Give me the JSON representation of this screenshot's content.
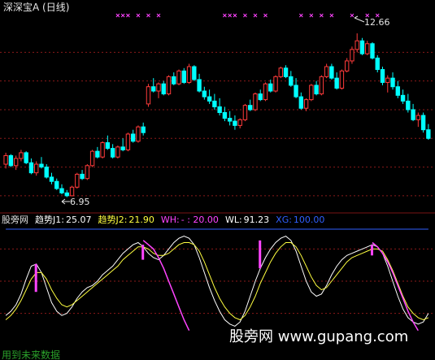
{
  "chart_data": [
    {
      "type": "candlestick",
      "title": "深深宝A (日线)",
      "annotations": {
        "high_label": "12.66",
        "low_label": "6.95"
      },
      "colors": {
        "up": "#ff3b3b",
        "down": "#00ffff",
        "marker": "#ff44ff",
        "grid": "#8a1a1a",
        "bg": "#000000"
      },
      "ylim": [
        6.6,
        13.2
      ],
      "grid_levels": [
        7.0,
        8.0,
        9.0,
        10.0,
        11.0,
        12.0
      ],
      "candles": [
        [
          8.1,
          8.5,
          7.95,
          8.4
        ],
        [
          8.4,
          8.45,
          8.0,
          8.05
        ],
        [
          8.05,
          8.4,
          7.9,
          8.3
        ],
        [
          8.3,
          8.6,
          8.2,
          8.5
        ],
        [
          8.5,
          8.55,
          8.1,
          8.15
        ],
        [
          8.15,
          8.3,
          7.75,
          7.8
        ],
        [
          7.8,
          8.2,
          7.7,
          8.1
        ],
        [
          8.1,
          8.35,
          7.95,
          8.0
        ],
        [
          8.0,
          8.1,
          7.6,
          7.65
        ],
        [
          7.65,
          7.8,
          7.4,
          7.5
        ],
        [
          7.5,
          7.6,
          7.2,
          7.25
        ],
        [
          7.25,
          7.4,
          7.05,
          7.1
        ],
        [
          7.1,
          7.2,
          6.95,
          7.0
        ],
        [
          7.0,
          7.35,
          6.98,
          7.3
        ],
        [
          7.3,
          7.8,
          7.25,
          7.75
        ],
        [
          7.75,
          7.9,
          7.55,
          7.6
        ],
        [
          7.6,
          8.1,
          7.55,
          8.05
        ],
        [
          8.05,
          8.6,
          8.0,
          8.55
        ],
        [
          8.55,
          8.7,
          8.3,
          8.35
        ],
        [
          8.35,
          8.9,
          8.3,
          8.85
        ],
        [
          8.85,
          9.1,
          8.6,
          8.65
        ],
        [
          8.65,
          8.8,
          8.3,
          8.35
        ],
        [
          8.35,
          8.75,
          8.3,
          8.7
        ],
        [
          8.7,
          9.0,
          8.55,
          8.6
        ],
        [
          8.6,
          9.2,
          8.55,
          9.15
        ],
        [
          9.15,
          9.3,
          8.85,
          8.9
        ],
        [
          8.9,
          9.45,
          8.85,
          9.4
        ],
        [
          9.4,
          9.55,
          9.1,
          9.2
        ],
        [
          10.2,
          10.9,
          10.1,
          10.8
        ],
        [
          10.8,
          11.1,
          10.6,
          10.65
        ],
        [
          10.65,
          10.95,
          10.4,
          10.9
        ],
        [
          10.9,
          11.0,
          10.5,
          10.55
        ],
        [
          10.55,
          11.2,
          10.5,
          11.15
        ],
        [
          11.15,
          11.3,
          10.85,
          10.9
        ],
        [
          10.9,
          11.4,
          10.85,
          11.35
        ],
        [
          11.35,
          11.45,
          10.9,
          10.95
        ],
        [
          10.95,
          11.6,
          10.9,
          11.5
        ],
        [
          11.5,
          11.55,
          11.0,
          11.05
        ],
        [
          11.05,
          11.25,
          10.6,
          10.65
        ],
        [
          10.65,
          10.8,
          10.35,
          10.45
        ],
        [
          10.45,
          10.7,
          10.2,
          10.3
        ],
        [
          10.3,
          10.55,
          10.0,
          10.1
        ],
        [
          10.1,
          10.4,
          9.8,
          9.9
        ],
        [
          9.9,
          10.1,
          9.6,
          9.7
        ],
        [
          9.7,
          9.95,
          9.45,
          9.6
        ],
        [
          9.6,
          9.8,
          9.3,
          9.45
        ],
        [
          9.45,
          9.7,
          9.35,
          9.65
        ],
        [
          9.65,
          10.2,
          9.6,
          10.15
        ],
        [
          10.15,
          10.35,
          9.95,
          10.0
        ],
        [
          10.0,
          10.6,
          9.95,
          10.55
        ],
        [
          10.55,
          10.7,
          10.3,
          10.35
        ],
        [
          10.35,
          10.95,
          10.3,
          10.9
        ],
        [
          10.9,
          11.05,
          10.6,
          10.65
        ],
        [
          10.65,
          11.2,
          10.6,
          11.15
        ],
        [
          11.15,
          11.5,
          11.1,
          11.45
        ],
        [
          11.45,
          11.55,
          11.1,
          11.15
        ],
        [
          11.15,
          11.35,
          10.8,
          10.85
        ],
        [
          10.85,
          11.1,
          10.4,
          10.45
        ],
        [
          10.45,
          10.6,
          10.0,
          10.05
        ],
        [
          10.05,
          10.4,
          9.95,
          10.35
        ],
        [
          10.35,
          10.9,
          10.3,
          10.85
        ],
        [
          10.85,
          11.0,
          10.5,
          10.55
        ],
        [
          10.55,
          11.2,
          10.5,
          11.15
        ],
        [
          11.15,
          11.6,
          11.1,
          11.5
        ],
        [
          11.5,
          11.6,
          11.05,
          11.1
        ],
        [
          11.1,
          11.3,
          10.7,
          10.75
        ],
        [
          10.75,
          11.4,
          10.7,
          11.35
        ],
        [
          11.35,
          11.8,
          11.3,
          11.7
        ],
        [
          11.7,
          12.2,
          11.6,
          12.1
        ],
        [
          12.1,
          12.66,
          12.0,
          12.4
        ],
        [
          12.4,
          12.5,
          11.9,
          11.95
        ],
        [
          11.95,
          12.4,
          11.9,
          12.3
        ],
        [
          12.3,
          12.35,
          11.75,
          11.8
        ],
        [
          11.8,
          11.9,
          11.3,
          11.4
        ],
        [
          11.4,
          11.5,
          10.85,
          10.95
        ],
        [
          10.95,
          11.2,
          10.6,
          11.1
        ],
        [
          11.1,
          11.3,
          10.7,
          10.8
        ],
        [
          10.8,
          11.0,
          10.4,
          10.5
        ],
        [
          10.5,
          10.7,
          10.2,
          10.3
        ],
        [
          10.3,
          10.55,
          9.9,
          10.0
        ],
        [
          10.0,
          10.2,
          9.6,
          9.65
        ],
        [
          9.65,
          9.9,
          9.4,
          9.8
        ],
        [
          9.8,
          9.9,
          9.2,
          9.3
        ],
        [
          9.3,
          9.5,
          8.95,
          9.0
        ]
      ]
    },
    {
      "type": "line",
      "legend": [
        {
          "label": "股旁网",
          "value": "",
          "color": "#e0e0e0"
        },
        {
          "label": "趋势J1:",
          "value": "25.07",
          "color": "#ffffff"
        },
        {
          "label": "趋势J2:",
          "value": "21.90",
          "color": "#ffff40"
        },
        {
          "label": "WH:",
          "value": "- : 20.00",
          "color": "#ff44ff"
        },
        {
          "label": "WL:",
          "value": "91.23",
          "color": "#ffffff"
        },
        {
          "label": "XG:",
          "value": "100.00",
          "color": "#3060ff"
        }
      ],
      "ylim": [
        0,
        100
      ],
      "series": [
        {
          "name": "趋势J1",
          "color": "#ffffff",
          "values": [
            18,
            22,
            28,
            38,
            52,
            64,
            66,
            58,
            44,
            30,
            22,
            18,
            20,
            26,
            34,
            40,
            44,
            46,
            50,
            56,
            60,
            64,
            70,
            76,
            80,
            84,
            86,
            82,
            76,
            72,
            70,
            74,
            80,
            86,
            90,
            92,
            90,
            84,
            72,
            58,
            44,
            32,
            22,
            14,
            10,
            8,
            12,
            22,
            36,
            50,
            62,
            72,
            80,
            86,
            90,
            92,
            88,
            78,
            64,
            50,
            40,
            36,
            38,
            46,
            56,
            64,
            70,
            74,
            76,
            78,
            80,
            82,
            84,
            82,
            76,
            64,
            50,
            36,
            24,
            16,
            12,
            10,
            12,
            20
          ]
        },
        {
          "name": "趋势J2",
          "color": "#ffff40",
          "values": [
            14,
            18,
            24,
            32,
            42,
            52,
            58,
            58,
            52,
            42,
            34,
            28,
            26,
            28,
            32,
            36,
            40,
            44,
            48,
            52,
            56,
            60,
            64,
            70,
            74,
            78,
            82,
            82,
            80,
            76,
            74,
            74,
            76,
            80,
            84,
            86,
            86,
            84,
            78,
            68,
            56,
            44,
            34,
            26,
            20,
            16,
            14,
            18,
            26,
            36,
            48,
            58,
            68,
            76,
            82,
            86,
            86,
            82,
            74,
            64,
            54,
            46,
            42,
            44,
            50,
            56,
            62,
            68,
            72,
            74,
            76,
            78,
            80,
            80,
            78,
            70,
            60,
            48,
            36,
            26,
            20,
            16,
            14,
            16
          ]
        },
        {
          "name": "WH",
          "color": "#ff44ff",
          "values": [
            null,
            null,
            null,
            null,
            null,
            null,
            null,
            null,
            null,
            null,
            null,
            null,
            null,
            null,
            null,
            null,
            null,
            null,
            null,
            null,
            null,
            null,
            null,
            null,
            null,
            null,
            null,
            88,
            84,
            80,
            72,
            62,
            50,
            38,
            26,
            14,
            4,
            null,
            null,
            null,
            null,
            null,
            null,
            null,
            null,
            null,
            null,
            null,
            null,
            null,
            null,
            null,
            null,
            null,
            null,
            null,
            null,
            null,
            null,
            null,
            null,
            null,
            null,
            null,
            null,
            null,
            null,
            null,
            null,
            null,
            null,
            null,
            86,
            82,
            76,
            68,
            58,
            46,
            34,
            22,
            12,
            4,
            null,
            null
          ]
        },
        {
          "name": "XG",
          "color": "#3060ff",
          "values": [
            100,
            100,
            100,
            100,
            100,
            100,
            100,
            100,
            100,
            100,
            100,
            100,
            100,
            100,
            100,
            100,
            100,
            100,
            100,
            100,
            100,
            100,
            100,
            100,
            100,
            100,
            100,
            100,
            100,
            100,
            100,
            100,
            100,
            100,
            100,
            100,
            100,
            100,
            100,
            100,
            100,
            100,
            100,
            100,
            100,
            100,
            100,
            100,
            100,
            100,
            100,
            100,
            100,
            100,
            100,
            100,
            100,
            100,
            100,
            100,
            100,
            100,
            100,
            100,
            100,
            100,
            100,
            100,
            100,
            100,
            100,
            100,
            100,
            100,
            100,
            100,
            100,
            100,
            100,
            100,
            100,
            100,
            100,
            100
          ]
        },
        {
          "name": "WL",
          "color": "#2a2",
          "values": []
        }
      ]
    }
  ],
  "branding": {
    "watermark": "股旁网 www.gupang.com",
    "footer": "用到未来数据"
  }
}
